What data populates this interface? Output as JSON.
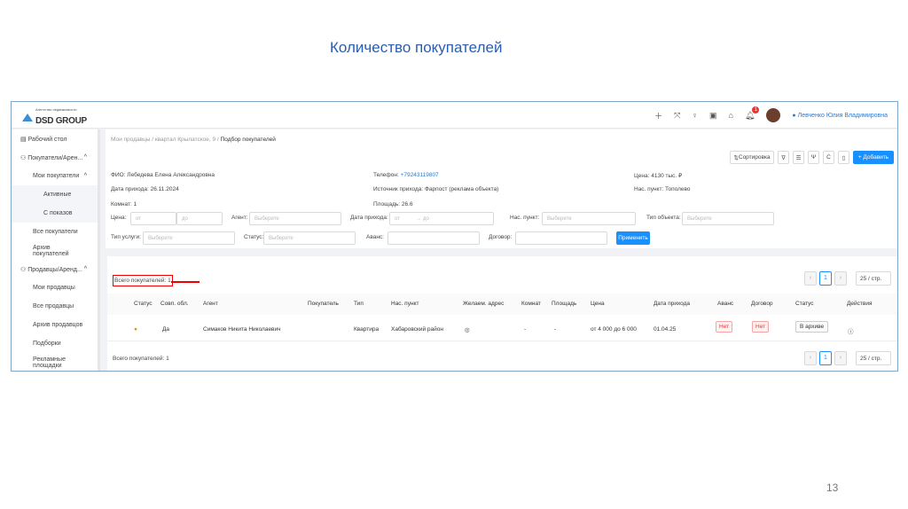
{
  "slide": {
    "title": "Количество покупателей",
    "page_number": "13"
  },
  "header": {
    "logo_sub": "Агентство недвижимости",
    "logo_name": "DSD GROUP",
    "icons": [
      "plus-icon",
      "fullscreen-icon",
      "bulb-icon",
      "wallet-icon",
      "gift-icon",
      "bell-icon"
    ],
    "notifications": "1",
    "user": "Левченко Юлия Владимировна"
  },
  "sidebar": {
    "items": [
      {
        "label": "Рабочий стол"
      },
      {
        "label": "Покупатели/Арен..."
      },
      {
        "label": "Мои покупатели"
      },
      {
        "label": "Активные"
      },
      {
        "label": "С показов"
      },
      {
        "label": "Все покупатели"
      },
      {
        "label": "Архив покупателей"
      },
      {
        "label": "Продавцы/Аренд..."
      },
      {
        "label": "Мои продавцы"
      },
      {
        "label": "Все продавцы"
      },
      {
        "label": "Архив продавцов"
      },
      {
        "label": "Подборки"
      },
      {
        "label": "Рекламные площадки"
      }
    ]
  },
  "breadcrumb": {
    "path": "Мои продавцы / квартал Крылатское, 9 / ",
    "current": "Подбор покупателей"
  },
  "toolbar": {
    "sort": "Сортировка",
    "add": "+ Добавить"
  },
  "info": {
    "fio_label": "ФИО:",
    "fio": "Лебедева Елена Александровна",
    "date_label": "Дата прихода:",
    "date": "26.11.2024",
    "rooms_label": "Комнат:",
    "rooms": "1",
    "phone_label": "Телефон:",
    "phone": "+79243119807",
    "source_label": "Источник прихода:",
    "source": "Фарпост (реклама объекта)",
    "area_label": "Площадь:",
    "area": "26.6",
    "price_label": "Цена:",
    "price": "4130 тыс. ₽",
    "city_label": "Нас. пункт:",
    "city": "Тополево"
  },
  "filters": {
    "price": "Цена:",
    "from": "от",
    "to": "до",
    "agent": "Агент:",
    "select": "Выберите",
    "date": "Дата прихода:",
    "date_to": "→ до",
    "city": "Нас. пункт:",
    "obj": "Тип объекта:",
    "service": "Тип услуги:",
    "status": "Статус:",
    "advance": "Аванс:",
    "contract": "Договор:",
    "apply": "Применить"
  },
  "table": {
    "total": "Всего покупателей: 1",
    "columns": [
      "Статус",
      "Совп. обл.",
      "Агент",
      "Покупатель",
      "Тип",
      "Нас. пункт",
      "Желаем. адрес",
      "Комнат",
      "Площадь",
      "Цена",
      "Дата прихода",
      "Аванс",
      "Договор",
      "Статус",
      "Действия"
    ],
    "rows": [
      {
        "match": "Да",
        "agent": "Симаков Никита Николаевич",
        "buyer": "",
        "type": "Квартира",
        "city": "Хабаровский район",
        "rooms": "-",
        "area": "-",
        "price": "от 4 000 до 6 000",
        "date": "01.04.25",
        "advance": "Нет",
        "contract": "Нет",
        "status": "В архиве"
      }
    ],
    "page": "1",
    "page_size": "25 / стр."
  },
  "colors": {
    "accent": "#1890ff",
    "title": "#2a5db0",
    "highlight": "#e00000"
  }
}
